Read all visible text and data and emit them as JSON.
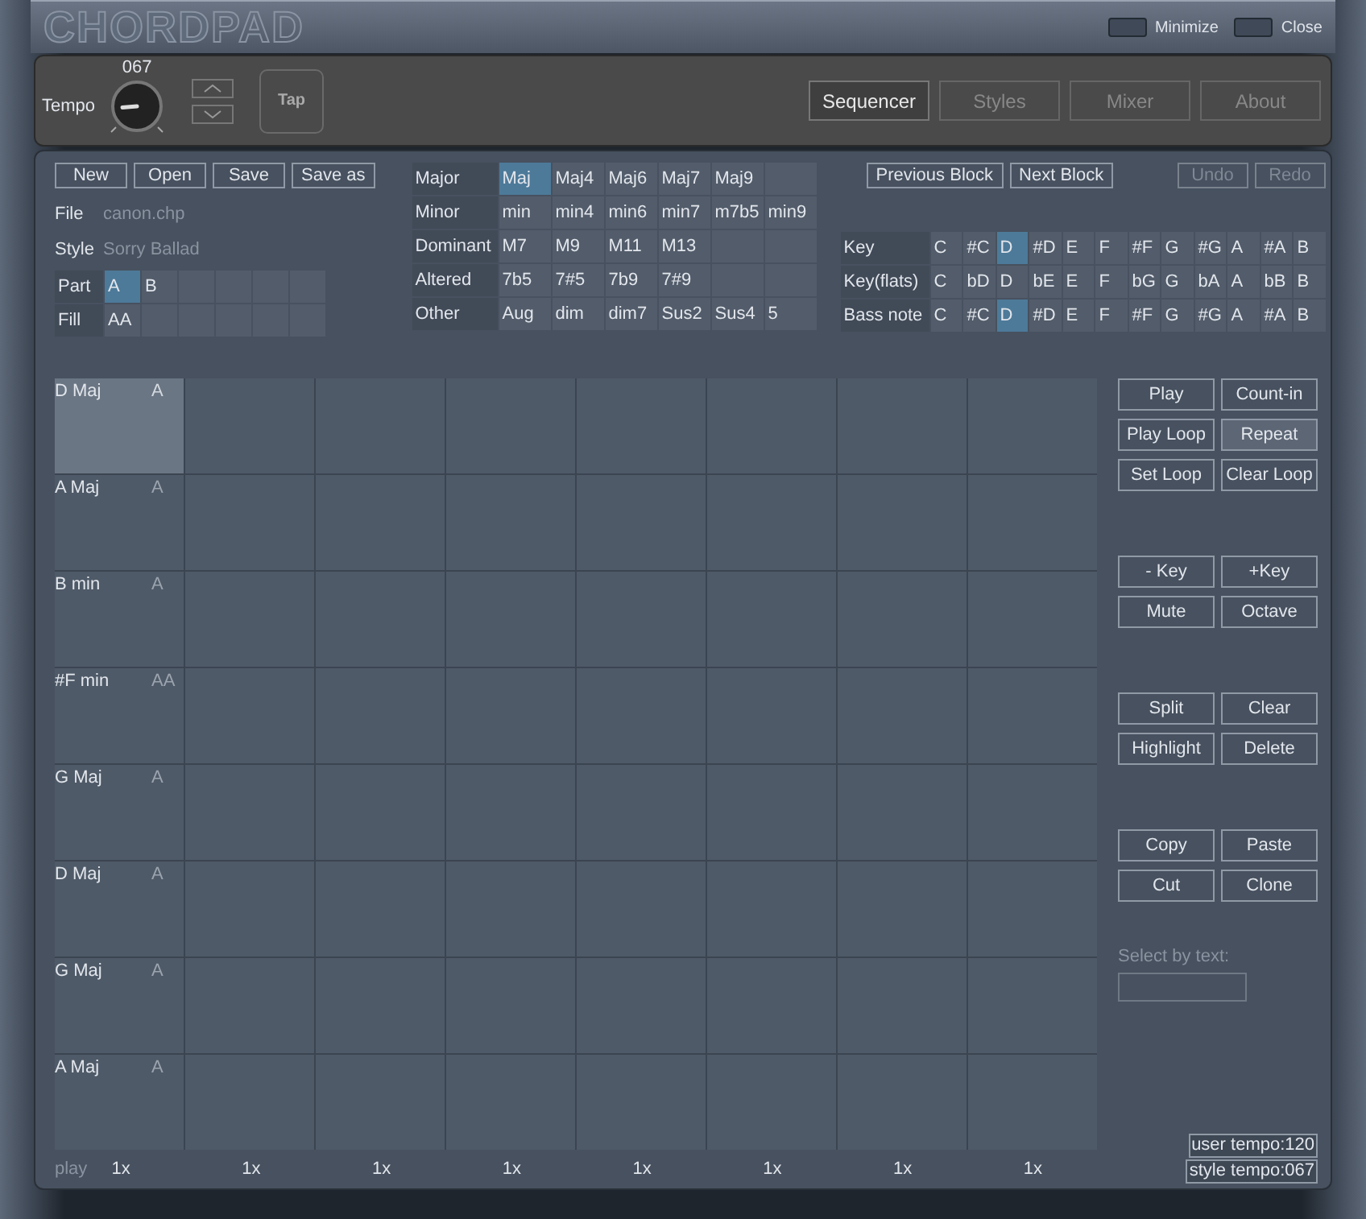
{
  "window": {
    "logo": {
      "filled": "CHORD",
      "outline": "PAD"
    },
    "controls": [
      "Minimize",
      "Close"
    ]
  },
  "toolbar": {
    "tempo_label": "Tempo",
    "tempo_value": "067",
    "tap": "Tap",
    "tabs": [
      {
        "label": "Sequencer",
        "selected": true
      },
      {
        "label": "Styles",
        "selected": false
      },
      {
        "label": "Mixer",
        "selected": false
      },
      {
        "label": "About",
        "selected": false
      }
    ]
  },
  "file_buttons": [
    "New",
    "Open",
    "Save",
    "Save as"
  ],
  "file_info": [
    {
      "label": "File",
      "value": "canon.chp"
    },
    {
      "label": "Style",
      "value": "Sorry Ballad"
    }
  ],
  "parts": [
    {
      "label": "Part",
      "cells": [
        {
          "text": "A",
          "selected": true
        },
        {
          "text": "B",
          "selected": false
        }
      ]
    },
    {
      "label": "Fill",
      "cells": [
        {
          "text": "AA",
          "selected": false
        }
      ]
    }
  ],
  "chord_types": [
    {
      "label": "Major",
      "chords": [
        {
          "text": "Maj",
          "selected": true
        },
        {
          "text": "Maj4",
          "selected": false
        },
        {
          "text": "Maj6",
          "selected": false
        },
        {
          "text": "Maj7",
          "selected": false
        },
        {
          "text": "Maj9",
          "selected": false
        }
      ]
    },
    {
      "label": "Minor",
      "chords": [
        {
          "text": "min",
          "selected": false
        },
        {
          "text": "min4",
          "selected": false
        },
        {
          "text": "min6",
          "selected": false
        },
        {
          "text": "min7",
          "selected": false
        },
        {
          "text": "m7b5",
          "selected": false
        },
        {
          "text": "min9",
          "selected": false
        }
      ]
    },
    {
      "label": "Dominant",
      "chords": [
        {
          "text": "M7",
          "selected": false
        },
        {
          "text": "M9",
          "selected": false
        },
        {
          "text": "M11",
          "selected": false
        },
        {
          "text": "M13",
          "selected": false
        }
      ]
    },
    {
      "label": "Altered",
      "chords": [
        {
          "text": "7b5",
          "selected": false
        },
        {
          "text": "7#5",
          "selected": false
        },
        {
          "text": "7b9",
          "selected": false
        },
        {
          "text": "7#9",
          "selected": false
        }
      ]
    },
    {
      "label": "Other",
      "chords": [
        {
          "text": "Aug",
          "selected": false
        },
        {
          "text": "dim",
          "selected": false
        },
        {
          "text": "dim7",
          "selected": false
        },
        {
          "text": "Sus2",
          "selected": false
        },
        {
          "text": "Sus4",
          "selected": false
        },
        {
          "text": "5",
          "selected": false
        }
      ]
    }
  ],
  "block_buttons": [
    {
      "label": "Previous Block",
      "disabled": false
    },
    {
      "label": "Next Block",
      "disabled": false
    }
  ],
  "history_buttons": [
    {
      "label": "Undo",
      "disabled": true
    },
    {
      "label": "Redo",
      "disabled": true
    }
  ],
  "keys": [
    {
      "label": "Key",
      "notes": [
        {
          "text": "C",
          "selected": false
        },
        {
          "text": "#C",
          "selected": false
        },
        {
          "text": "D",
          "selected": true
        },
        {
          "text": "#D",
          "selected": false
        },
        {
          "text": "E",
          "selected": false
        },
        {
          "text": "F",
          "selected": false
        },
        {
          "text": "#F",
          "selected": false
        },
        {
          "text": "G",
          "selected": false
        },
        {
          "text": "#G",
          "selected": false
        },
        {
          "text": "A",
          "selected": false
        },
        {
          "text": "#A",
          "selected": false
        },
        {
          "text": "B",
          "selected": false
        }
      ]
    },
    {
      "label": "Key(flats)",
      "notes": [
        {
          "text": "C",
          "selected": false
        },
        {
          "text": "bD",
          "selected": false
        },
        {
          "text": "D",
          "selected": false
        },
        {
          "text": "bE",
          "selected": false
        },
        {
          "text": "E",
          "selected": false
        },
        {
          "text": "F",
          "selected": false
        },
        {
          "text": "bG",
          "selected": false
        },
        {
          "text": "G",
          "selected": false
        },
        {
          "text": "bA",
          "selected": false
        },
        {
          "text": "A",
          "selected": false
        },
        {
          "text": "bB",
          "selected": false
        },
        {
          "text": "B",
          "selected": false
        }
      ]
    },
    {
      "label": "Bass note",
      "notes": [
        {
          "text": "C",
          "selected": false
        },
        {
          "text": "#C",
          "selected": false
        },
        {
          "text": "D",
          "selected": true
        },
        {
          "text": "#D",
          "selected": false
        },
        {
          "text": "E",
          "selected": false
        },
        {
          "text": "F",
          "selected": false
        },
        {
          "text": "#F",
          "selected": false
        },
        {
          "text": "G",
          "selected": false
        },
        {
          "text": "#G",
          "selected": false
        },
        {
          "text": "A",
          "selected": false
        },
        {
          "text": "#A",
          "selected": false
        },
        {
          "text": "B",
          "selected": false
        }
      ]
    }
  ],
  "sequence": [
    {
      "chord": "D Maj",
      "part": "A",
      "selected": true
    },
    {
      "chord": "A Maj",
      "part": "A",
      "selected": false
    },
    {
      "chord": "B min",
      "part": "A",
      "selected": false
    },
    {
      "chord": "#F min",
      "part": "AA",
      "selected": false
    },
    {
      "chord": "G Maj",
      "part": "A",
      "selected": false
    },
    {
      "chord": "D Maj",
      "part": "A",
      "selected": false
    },
    {
      "chord": "G Maj",
      "part": "A",
      "selected": false
    },
    {
      "chord": "A Maj",
      "part": "A",
      "selected": false
    }
  ],
  "footer": {
    "label": "play",
    "repeats": [
      "1x",
      "1x",
      "1x",
      "1x",
      "1x",
      "1x",
      "1x",
      "1x"
    ]
  },
  "side_groups": [
    [
      {
        "label": "Play",
        "active": false
      },
      {
        "label": "Count-in",
        "active": false
      },
      {
        "label": "Play Loop",
        "active": false
      },
      {
        "label": "Repeat",
        "active": true
      },
      {
        "label": "Set Loop",
        "active": false
      },
      {
        "label": "Clear Loop",
        "active": false
      }
    ],
    [
      {
        "label": "- Key",
        "active": false
      },
      {
        "label": "+Key",
        "active": false
      },
      {
        "label": "Mute",
        "active": false
      },
      {
        "label": "Octave",
        "active": false
      }
    ],
    [
      {
        "label": "Split",
        "active": false
      },
      {
        "label": "Clear",
        "active": false
      },
      {
        "label": "Highlight",
        "active": false
      },
      {
        "label": "Delete",
        "active": false
      }
    ],
    [
      {
        "label": "Copy",
        "active": false
      },
      {
        "label": "Paste",
        "active": false
      },
      {
        "label": "Cut",
        "active": false
      },
      {
        "label": "Clone",
        "active": false
      }
    ]
  ],
  "select_by_text": {
    "label": "Select by text:"
  },
  "status": [
    "user tempo:120",
    "style tempo:067"
  ]
}
